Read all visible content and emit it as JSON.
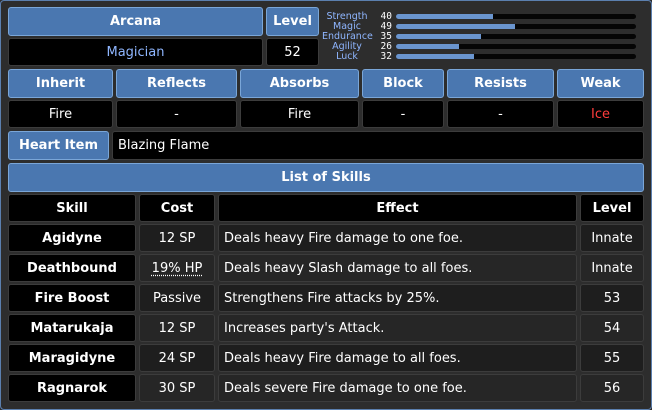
{
  "persona": {
    "arcana_header": "Arcana",
    "arcana_value": "Magician",
    "level_header": "Level",
    "level_value": "52"
  },
  "stats": [
    {
      "label": "Strength",
      "value": 40
    },
    {
      "label": "Magic",
      "value": 49
    },
    {
      "label": "Endurance",
      "value": 35
    },
    {
      "label": "Agility",
      "value": 26
    },
    {
      "label": "Luck",
      "value": 32
    }
  ],
  "affinities": {
    "headers": [
      "Inherit",
      "Reflects",
      "Absorbs",
      "Block",
      "Resists",
      "Weak"
    ],
    "values": [
      "Fire",
      "-",
      "Fire",
      "-",
      "-",
      "Ice"
    ],
    "weak_color": "#ff3c3c"
  },
  "heart_item": {
    "label": "Heart Item",
    "value": "Blazing Flame"
  },
  "skills": {
    "title": "List of Skills",
    "headers": [
      "Skill",
      "Cost",
      "Effect",
      "Level"
    ],
    "rows": [
      {
        "skill": "Agidyne",
        "cost": "12 SP",
        "effect": "Deals heavy Fire damage to one foe.",
        "level": "Innate"
      },
      {
        "skill": "Deathbound",
        "cost": "19% HP",
        "effect": "Deals heavy Slash damage to all foes.",
        "level": "Innate"
      },
      {
        "skill": "Fire Boost",
        "cost": "Passive",
        "effect": "Strengthens Fire attacks by 25%.",
        "level": "53"
      },
      {
        "skill": "Matarukaja",
        "cost": "12 SP",
        "effect": "Increases party's Attack.",
        "level": "54"
      },
      {
        "skill": "Maragidyne",
        "cost": "24 SP",
        "effect": "Deals heavy Fire damage to all foes.",
        "level": "55"
      },
      {
        "skill": "Ragnarok",
        "cost": "30 SP",
        "effect": "Deals severe Fire damage to one foe.",
        "level": "56"
      }
    ]
  },
  "colors": {
    "header_bg": "#4a77b0",
    "cell_bg": "#000000",
    "accent_text": "#8fb6ff",
    "stat_bar": "#6a95cf"
  }
}
